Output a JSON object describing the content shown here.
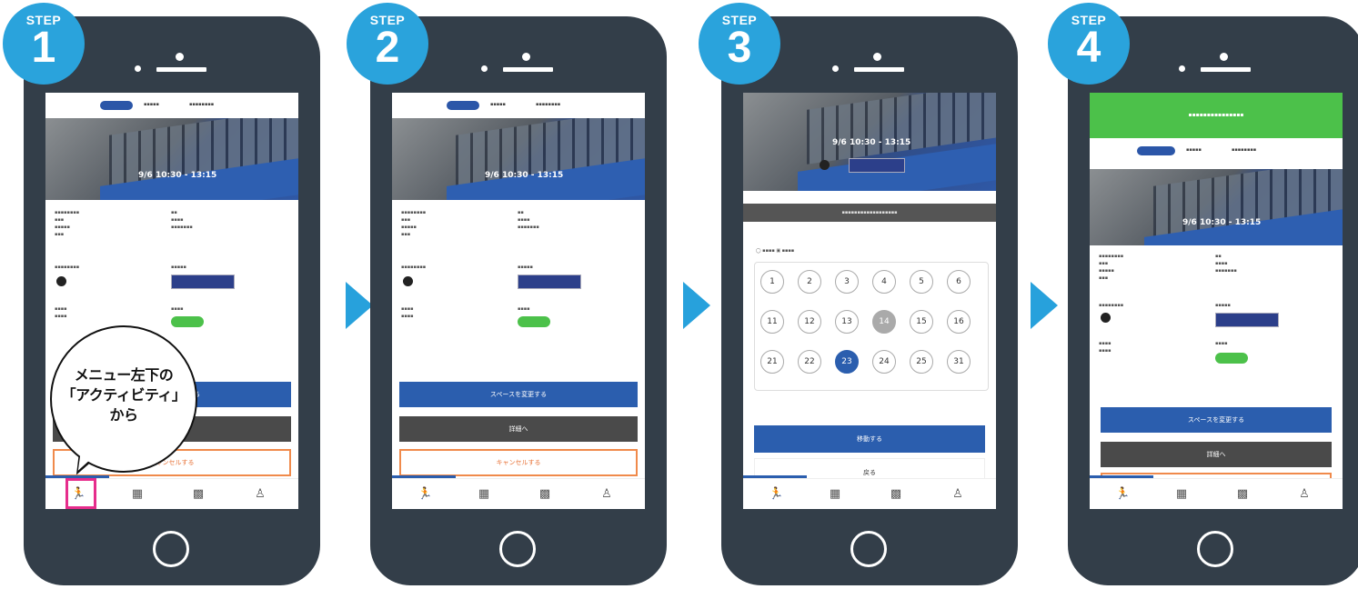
{
  "steps": [
    {
      "label": "STEP",
      "number": "1"
    },
    {
      "label": "STEP",
      "number": "2"
    },
    {
      "label": "STEP",
      "number": "3"
    },
    {
      "label": "STEP",
      "number": "4"
    }
  ],
  "callout": {
    "line1": "メニュー左下の",
    "line2": "「アクティビティ」",
    "line3": "から"
  },
  "app": {
    "hero_time": "9/6 10:30 - 13:15",
    "change_space_button": "スペースを変更する",
    "detail_button": "詳細へ",
    "cancel_button": "キャンセルする",
    "confirm_button": "移動する",
    "back_button": "戻る"
  },
  "calendar": {
    "row1": [
      "1",
      "2",
      "3",
      "4",
      "5",
      "6"
    ],
    "row2": [
      "11",
      "12",
      "13",
      "14",
      "15",
      "16"
    ],
    "row3": [
      "21",
      "22",
      "23",
      "24",
      "25",
      "31"
    ]
  },
  "colors": {
    "phone": "#333e49",
    "badge": "#2aa3dc",
    "arrow": "#27a1dc",
    "highlight": "#e62d8c",
    "primary": "#2b5eae",
    "success": "#4cc14a"
  }
}
